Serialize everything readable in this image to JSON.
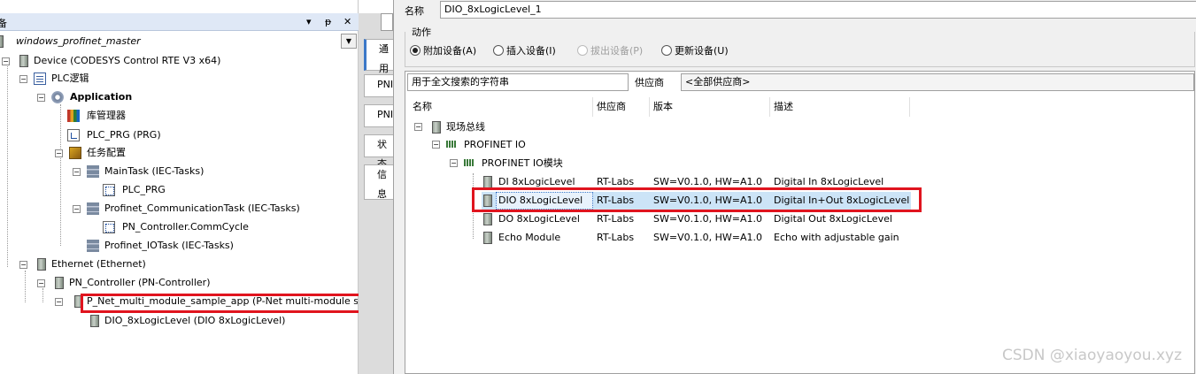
{
  "left_panel": {
    "title_fragment": "备",
    "controls": [
      "▾",
      "ᵽ",
      "✕"
    ],
    "root": "windows_profinet_master",
    "tree": [
      {
        "label": "Device (CODESYS Control RTE V3 x64)"
      },
      {
        "label": "PLC逻辑"
      },
      {
        "label": "Application"
      },
      {
        "label": "库管理器"
      },
      {
        "label": "PLC_PRG (PRG)"
      },
      {
        "label": "任务配置"
      },
      {
        "label": "MainTask (IEC-Tasks)"
      },
      {
        "label": "PLC_PRG"
      },
      {
        "label": "Profinet_CommunicationTask (IEC-Tasks)"
      },
      {
        "label": "PN_Controller.CommCycle"
      },
      {
        "label": "Profinet_IOTask (IEC-Tasks)"
      },
      {
        "label": "Ethernet (Ethernet)"
      },
      {
        "label": "PN_Controller (PN-Controller)"
      },
      {
        "label": "P_Net_multi_module_sample_app (P-Net multi-module sample ap"
      },
      {
        "label": "DIO_8xLogicLevel (DIO 8xLogicLevel)"
      }
    ]
  },
  "side_tabs": [
    "通用",
    "PNI",
    "PNI",
    "状态",
    "信息"
  ],
  "dialog": {
    "name_label": "名称",
    "name_value": "DIO_8xLogicLevel_1",
    "action_label": "动作",
    "radios": [
      {
        "label": "附加设备(A)",
        "checked": true,
        "enabled": true
      },
      {
        "label": "插入设备(I)",
        "checked": false,
        "enabled": true
      },
      {
        "label": "拔出设备(P)",
        "checked": false,
        "enabled": false
      },
      {
        "label": "更新设备(U)",
        "checked": false,
        "enabled": true
      }
    ],
    "search_placeholder": "用于全文搜索的字符串",
    "vendor_label": "供应商",
    "vendor_value": "<全部供应商>",
    "columns": [
      "名称",
      "供应商",
      "版本",
      "描述"
    ],
    "catalog": {
      "group1": "现场总线",
      "group2": "PROFINET IO",
      "group3": "PROFINET IO模块",
      "modules": [
        {
          "name": "DI 8xLogicLevel",
          "vendor": "RT-Labs",
          "version": "SW=V0.1.0, HW=A1.0",
          "desc": "Digital In 8xLogicLevel"
        },
        {
          "name": "DIO 8xLogicLevel",
          "vendor": "RT-Labs",
          "version": "SW=V0.1.0, HW=A1.0",
          "desc": "Digital In+Out 8xLogicLevel"
        },
        {
          "name": "DO 8xLogicLevel",
          "vendor": "RT-Labs",
          "version": "SW=V0.1.0, HW=A1.0",
          "desc": "Digital Out 8xLogicLevel"
        },
        {
          "name": "Echo Module",
          "vendor": "RT-Labs",
          "version": "SW=V0.1.0, HW=A1.0",
          "desc": "Echo with adjustable gain"
        }
      ]
    }
  },
  "watermark": "CSDN @xiaoyaoyou.xyz",
  "colors": {
    "highlight": "#e0141e",
    "selection": "#cce4f7",
    "header": "#dfe8f6"
  }
}
